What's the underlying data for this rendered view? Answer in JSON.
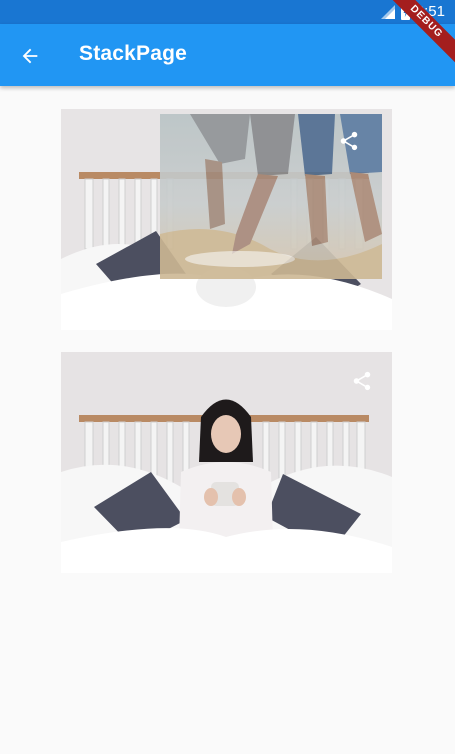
{
  "status_bar": {
    "time": "2:51",
    "battery_icon": "battery-icon",
    "signal_icon": "signal-icon"
  },
  "debug_banner": {
    "label": "DEBUG"
  },
  "app_bar": {
    "title": "StackPage",
    "back_icon": "arrow-back-icon"
  },
  "cards": [
    {
      "photo": "woman-in-bed-photo",
      "overlay_photo": "beach-feet-photo",
      "share_icon": "share-icon"
    },
    {
      "photo": "woman-in-bed-photo",
      "share_icon": "share-icon"
    }
  ],
  "colors": {
    "status_bar": "#1976d2",
    "app_bar": "#2196f3",
    "background": "#fafafa",
    "debug": "#a41e1e"
  }
}
